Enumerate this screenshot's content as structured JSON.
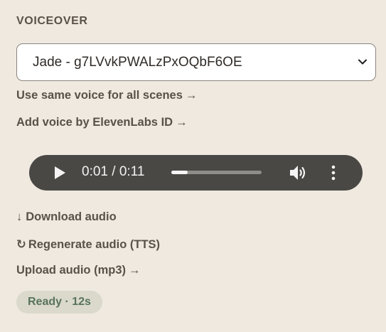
{
  "section": {
    "title": "VOICEOVER"
  },
  "voice_select": {
    "selected": "Jade - g7LVvkPWALzPxOQbF6OE"
  },
  "links": {
    "same_voice": "Use same voice for all scenes",
    "add_voice": "Add voice by ElevenLabs ID",
    "download": "Download audio",
    "regenerate": "Regenerate audio (TTS)",
    "upload": "Upload audio (mp3)",
    "arrow": "→",
    "download_glyph": "↓",
    "regenerate_glyph": "↻"
  },
  "player": {
    "time": "0:01 / 0:11",
    "progress": 0.18,
    "icons": {
      "play": "play-icon",
      "volume": "volume-icon",
      "menu": "more-vertical-icon"
    }
  },
  "status": {
    "text": "Ready · 12s"
  },
  "colors": {
    "background": "#efe9e0",
    "text": "#5a5148",
    "player_bg": "#4a4845",
    "badge_bg": "#dad9cb",
    "badge_text": "#58735e"
  }
}
